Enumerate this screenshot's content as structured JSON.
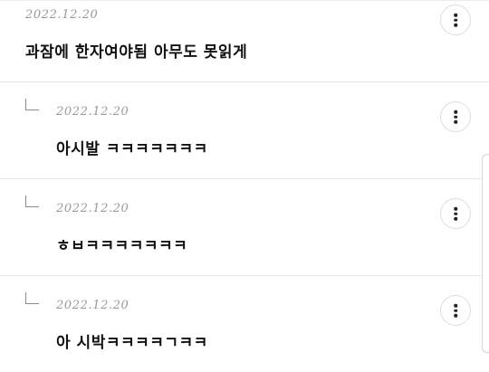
{
  "comments": [
    {
      "date": "2022.12.20",
      "text": "과잠에 한자여야됨 아무도 못읽게",
      "is_reply": false,
      "menu_icon": "more-vertical-icon"
    },
    {
      "date": "2022.12.20",
      "text": "아시발 ㅋㅋㅋㅋㅋㅋㅋ",
      "is_reply": true,
      "menu_icon": "more-vertical-icon"
    },
    {
      "date": "2022.12.20",
      "text": "ㅎㅂㅋㅋㅋㅋㅋㅋㅋ",
      "is_reply": true,
      "menu_icon": "more-vertical-icon"
    },
    {
      "date": "2022.12.20",
      "text": "아 시박ㅋㅋㅋㅋㄱㅋㅋ",
      "is_reply": true,
      "menu_icon": "more-vertical-icon"
    }
  ]
}
